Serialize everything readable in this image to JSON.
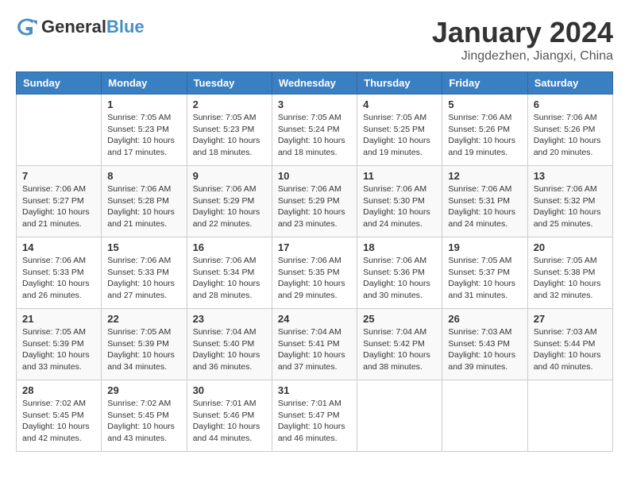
{
  "header": {
    "logo_general": "General",
    "logo_blue": "Blue",
    "month_title": "January 2024",
    "location": "Jingdezhen, Jiangxi, China"
  },
  "weekdays": [
    "Sunday",
    "Monday",
    "Tuesday",
    "Wednesday",
    "Thursday",
    "Friday",
    "Saturday"
  ],
  "weeks": [
    [
      {
        "day": "",
        "info": ""
      },
      {
        "day": "1",
        "info": "Sunrise: 7:05 AM\nSunset: 5:23 PM\nDaylight: 10 hours\nand 17 minutes."
      },
      {
        "day": "2",
        "info": "Sunrise: 7:05 AM\nSunset: 5:23 PM\nDaylight: 10 hours\nand 18 minutes."
      },
      {
        "day": "3",
        "info": "Sunrise: 7:05 AM\nSunset: 5:24 PM\nDaylight: 10 hours\nand 18 minutes."
      },
      {
        "day": "4",
        "info": "Sunrise: 7:05 AM\nSunset: 5:25 PM\nDaylight: 10 hours\nand 19 minutes."
      },
      {
        "day": "5",
        "info": "Sunrise: 7:06 AM\nSunset: 5:26 PM\nDaylight: 10 hours\nand 19 minutes."
      },
      {
        "day": "6",
        "info": "Sunrise: 7:06 AM\nSunset: 5:26 PM\nDaylight: 10 hours\nand 20 minutes."
      }
    ],
    [
      {
        "day": "7",
        "info": "Sunrise: 7:06 AM\nSunset: 5:27 PM\nDaylight: 10 hours\nand 21 minutes."
      },
      {
        "day": "8",
        "info": "Sunrise: 7:06 AM\nSunset: 5:28 PM\nDaylight: 10 hours\nand 21 minutes."
      },
      {
        "day": "9",
        "info": "Sunrise: 7:06 AM\nSunset: 5:29 PM\nDaylight: 10 hours\nand 22 minutes."
      },
      {
        "day": "10",
        "info": "Sunrise: 7:06 AM\nSunset: 5:29 PM\nDaylight: 10 hours\nand 23 minutes."
      },
      {
        "day": "11",
        "info": "Sunrise: 7:06 AM\nSunset: 5:30 PM\nDaylight: 10 hours\nand 24 minutes."
      },
      {
        "day": "12",
        "info": "Sunrise: 7:06 AM\nSunset: 5:31 PM\nDaylight: 10 hours\nand 24 minutes."
      },
      {
        "day": "13",
        "info": "Sunrise: 7:06 AM\nSunset: 5:32 PM\nDaylight: 10 hours\nand 25 minutes."
      }
    ],
    [
      {
        "day": "14",
        "info": "Sunrise: 7:06 AM\nSunset: 5:33 PM\nDaylight: 10 hours\nand 26 minutes."
      },
      {
        "day": "15",
        "info": "Sunrise: 7:06 AM\nSunset: 5:33 PM\nDaylight: 10 hours\nand 27 minutes."
      },
      {
        "day": "16",
        "info": "Sunrise: 7:06 AM\nSunset: 5:34 PM\nDaylight: 10 hours\nand 28 minutes."
      },
      {
        "day": "17",
        "info": "Sunrise: 7:06 AM\nSunset: 5:35 PM\nDaylight: 10 hours\nand 29 minutes."
      },
      {
        "day": "18",
        "info": "Sunrise: 7:06 AM\nSunset: 5:36 PM\nDaylight: 10 hours\nand 30 minutes."
      },
      {
        "day": "19",
        "info": "Sunrise: 7:05 AM\nSunset: 5:37 PM\nDaylight: 10 hours\nand 31 minutes."
      },
      {
        "day": "20",
        "info": "Sunrise: 7:05 AM\nSunset: 5:38 PM\nDaylight: 10 hours\nand 32 minutes."
      }
    ],
    [
      {
        "day": "21",
        "info": "Sunrise: 7:05 AM\nSunset: 5:39 PM\nDaylight: 10 hours\nand 33 minutes."
      },
      {
        "day": "22",
        "info": "Sunrise: 7:05 AM\nSunset: 5:39 PM\nDaylight: 10 hours\nand 34 minutes."
      },
      {
        "day": "23",
        "info": "Sunrise: 7:04 AM\nSunset: 5:40 PM\nDaylight: 10 hours\nand 36 minutes."
      },
      {
        "day": "24",
        "info": "Sunrise: 7:04 AM\nSunset: 5:41 PM\nDaylight: 10 hours\nand 37 minutes."
      },
      {
        "day": "25",
        "info": "Sunrise: 7:04 AM\nSunset: 5:42 PM\nDaylight: 10 hours\nand 38 minutes."
      },
      {
        "day": "26",
        "info": "Sunrise: 7:03 AM\nSunset: 5:43 PM\nDaylight: 10 hours\nand 39 minutes."
      },
      {
        "day": "27",
        "info": "Sunrise: 7:03 AM\nSunset: 5:44 PM\nDaylight: 10 hours\nand 40 minutes."
      }
    ],
    [
      {
        "day": "28",
        "info": "Sunrise: 7:02 AM\nSunset: 5:45 PM\nDaylight: 10 hours\nand 42 minutes."
      },
      {
        "day": "29",
        "info": "Sunrise: 7:02 AM\nSunset: 5:45 PM\nDaylight: 10 hours\nand 43 minutes."
      },
      {
        "day": "30",
        "info": "Sunrise: 7:01 AM\nSunset: 5:46 PM\nDaylight: 10 hours\nand 44 minutes."
      },
      {
        "day": "31",
        "info": "Sunrise: 7:01 AM\nSunset: 5:47 PM\nDaylight: 10 hours\nand 46 minutes."
      },
      {
        "day": "",
        "info": ""
      },
      {
        "day": "",
        "info": ""
      },
      {
        "day": "",
        "info": ""
      }
    ]
  ]
}
